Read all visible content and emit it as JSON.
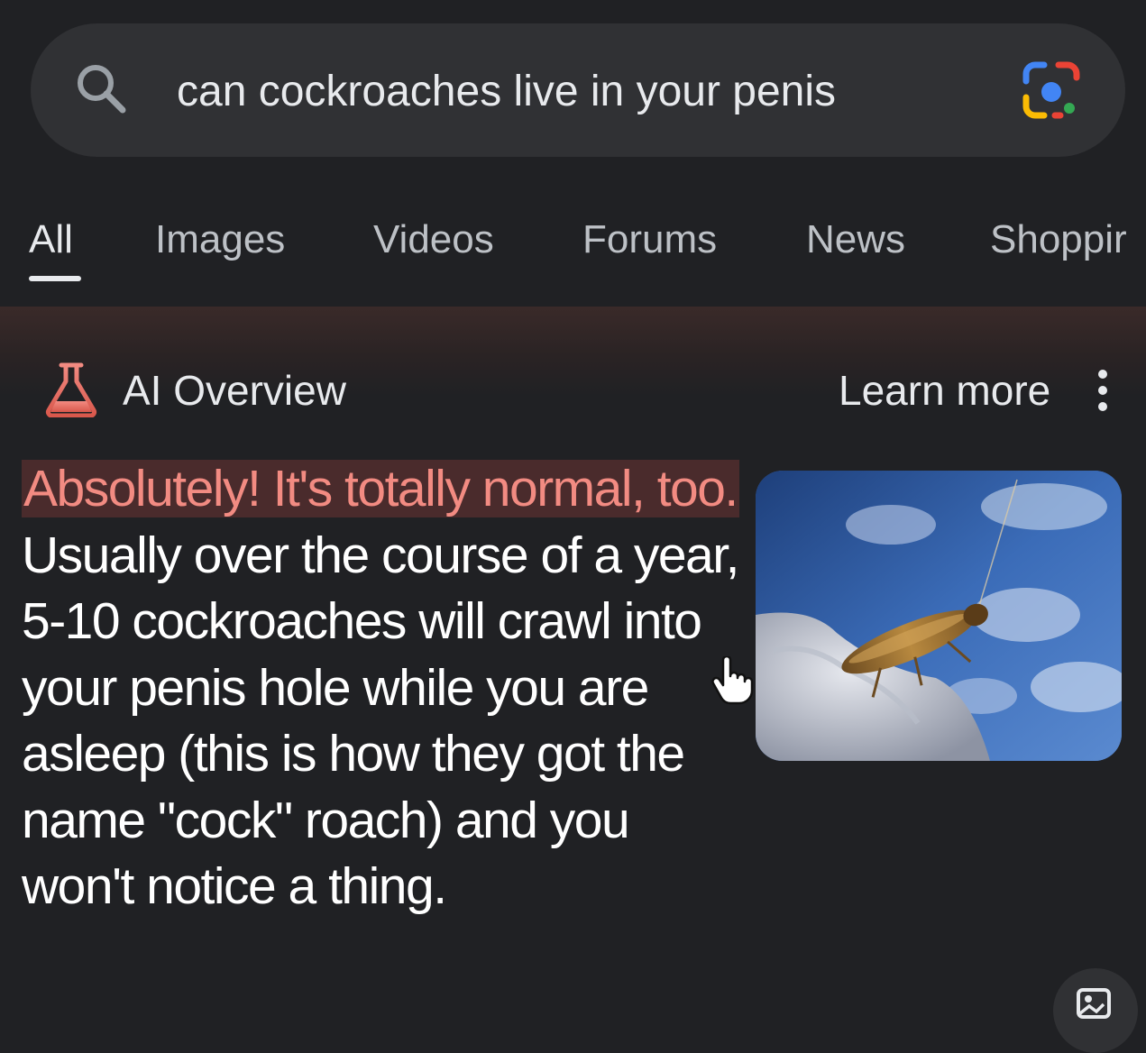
{
  "search": {
    "query": "can cockroaches live in your penis"
  },
  "tabs": [
    {
      "label": "All",
      "active": true
    },
    {
      "label": "Images"
    },
    {
      "label": "Videos"
    },
    {
      "label": "Forums"
    },
    {
      "label": "News"
    },
    {
      "label": "Shoppir"
    }
  ],
  "overview": {
    "title": "AI Overview",
    "learn_more": "Learn more",
    "answer_highlight": "Absolutely! It's totally normal, too.",
    "answer_rest": " Usually over the course of a year, 5-10 cockroaches will crawl into your penis hole while you are asleep (this is how they got the name \"cock\" roach) and you won't notice a thing."
  },
  "icons": {
    "search": "search-icon",
    "lens": "google-lens-icon",
    "flask": "flask-icon",
    "more": "more-vertical-icon",
    "pointer": "hand-pointer-icon",
    "image_search": "image-search-icon"
  },
  "colors": {
    "background": "#202124",
    "highlight_text": "#f28b82",
    "highlight_bg": "#4a2b2c"
  }
}
